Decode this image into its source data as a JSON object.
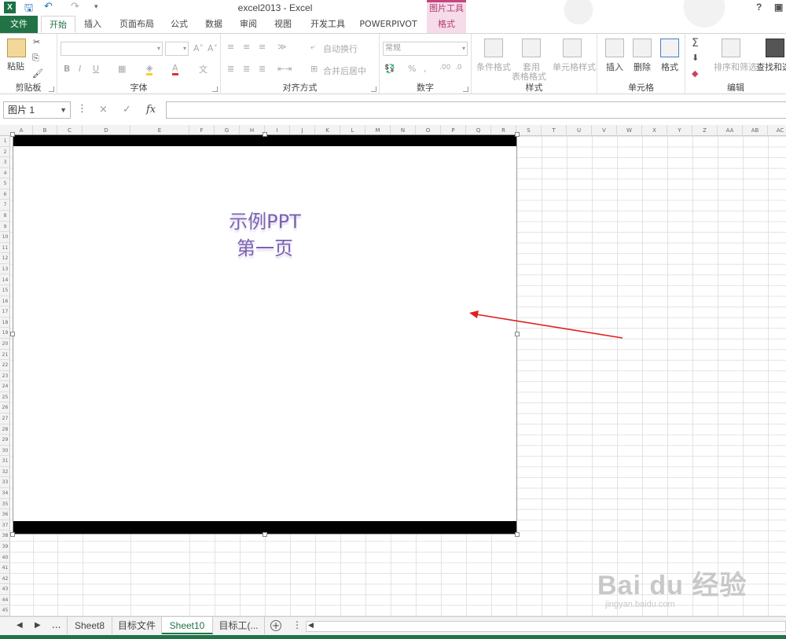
{
  "window": {
    "title": "excel2013 - Excel",
    "help": "?",
    "context_tab_group": "图片工具"
  },
  "tabs": [
    "文件",
    "开始",
    "插入",
    "页面布局",
    "公式",
    "数据",
    "审阅",
    "视图",
    "开发工具",
    "POWERPIVOT",
    "格式"
  ],
  "ribbon": {
    "clipboard": {
      "label": "剪贴板",
      "paste": "粘贴"
    },
    "font": {
      "label": "字体"
    },
    "alignment": {
      "label": "对齐方式",
      "wrap": "自动换行",
      "merge": "合并后居中"
    },
    "number": {
      "label": "数字",
      "format": "常规"
    },
    "styles": {
      "label": "样式",
      "cond": "条件格式",
      "table": "套用",
      "table2": "表格格式",
      "cell_style": "单元格样式"
    },
    "cells": {
      "label": "单元格",
      "insert": "插入",
      "delete": "删除",
      "format": "格式"
    },
    "editing": {
      "label": "编辑",
      "sort": "排序和筛选",
      "find": "查找和选"
    }
  },
  "formula_bar": {
    "name_box": "图片 1",
    "fx": "fx",
    "cancel": "×",
    "enter": "✓"
  },
  "columns": [
    "A",
    "B",
    "C",
    "D",
    "E",
    "F",
    "G",
    "H",
    "I",
    "J",
    "K",
    "L",
    "M",
    "N",
    "O",
    "P",
    "Q",
    "R",
    "S",
    "T",
    "U",
    "V",
    "W",
    "X",
    "Y",
    "Z",
    "AA",
    "AB",
    "AC"
  ],
  "rows": [
    "1",
    "2",
    "3",
    "4",
    "5",
    "6",
    "7",
    "8",
    "9",
    "10",
    "11",
    "12",
    "13",
    "14",
    "15",
    "16",
    "17",
    "18",
    "19",
    "20",
    "21",
    "22",
    "23",
    "24",
    "25",
    "26",
    "27",
    "28",
    "29",
    "30",
    "31",
    "32",
    "33",
    "34",
    "35",
    "36",
    "37",
    "38",
    "39",
    "40",
    "41",
    "42",
    "43",
    "44",
    "45"
  ],
  "picture": {
    "line1": "示例PPT",
    "line2": "第一页"
  },
  "sheets": [
    {
      "name": "Sheet8",
      "active": false
    },
    {
      "name": "目标文件",
      "active": false
    },
    {
      "name": "Sheet10",
      "active": true
    },
    {
      "name": "目标工(...",
      "active": false
    }
  ],
  "sheet_nav": {
    "ellipsis": "...",
    "add": "+"
  },
  "watermark": {
    "brand": "Bai du 经验",
    "url": "jingyan.baidu.com"
  },
  "colors": {
    "excel_green": "#217346",
    "context_pink": "#c4457f",
    "arrow_red": "#e02020"
  }
}
